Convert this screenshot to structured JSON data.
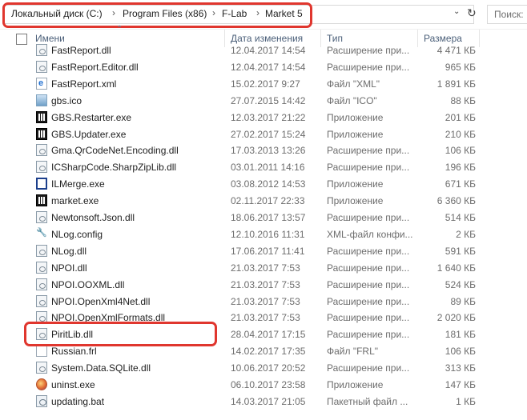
{
  "address": {
    "crumbs": [
      "Локальный диск (C:)",
      "Program Files (x86)",
      "F-Lab",
      "Market 5"
    ],
    "separator": "›",
    "dropdown_icon": "chevron-down-icon",
    "refresh_icon": "refresh-icon",
    "search_placeholder": "Поиск:"
  },
  "columns": {
    "name": "Имени",
    "date": "Дата изменения",
    "type": "Тип",
    "size": "Размера"
  },
  "highlight_color": "#e0362e",
  "files": [
    {
      "name": "FastReport.dll",
      "date": "12.04.2017 14:54",
      "type": "Расширение при...",
      "size": "4 471 КБ",
      "icon": "dll"
    },
    {
      "name": "FastReport.Editor.dll",
      "date": "12.04.2017 14:54",
      "type": "Расширение при...",
      "size": "965 КБ",
      "icon": "dll"
    },
    {
      "name": "FastReport.xml",
      "date": "15.02.2017 9:27",
      "type": "Файл \"XML\"",
      "size": "1 891 КБ",
      "icon": "xml"
    },
    {
      "name": "gbs.ico",
      "date": "27.07.2015 14:42",
      "type": "Файл \"ICO\"",
      "size": "88 КБ",
      "icon": "ico"
    },
    {
      "name": "GBS.Restarter.exe",
      "date": "12.03.2017 21:22",
      "type": "Приложение",
      "size": "201 КБ",
      "icon": "exe"
    },
    {
      "name": "GBS.Updater.exe",
      "date": "27.02.2017 15:24",
      "type": "Приложение",
      "size": "210 КБ",
      "icon": "exe"
    },
    {
      "name": "Gma.QrCodeNet.Encoding.dll",
      "date": "17.03.2013 13:26",
      "type": "Расширение при...",
      "size": "106 КБ",
      "icon": "dll"
    },
    {
      "name": "ICSharpCode.SharpZipLib.dll",
      "date": "03.01.2011 14:16",
      "type": "Расширение при...",
      "size": "196 КБ",
      "icon": "dll"
    },
    {
      "name": "ILMerge.exe",
      "date": "03.08.2012 14:53",
      "type": "Приложение",
      "size": "671 КБ",
      "icon": "il"
    },
    {
      "name": "market.exe",
      "date": "02.11.2017 22:33",
      "type": "Приложение",
      "size": "6 360 КБ",
      "icon": "exe"
    },
    {
      "name": "Newtonsoft.Json.dll",
      "date": "18.06.2017 13:57",
      "type": "Расширение при...",
      "size": "514 КБ",
      "icon": "dll"
    },
    {
      "name": "NLog.config",
      "date": "12.10.2016 11:31",
      "type": "XML-файл конфи...",
      "size": "2 КБ",
      "icon": "cfg"
    },
    {
      "name": "NLog.dll",
      "date": "17.06.2017 11:41",
      "type": "Расширение при...",
      "size": "591 КБ",
      "icon": "dll"
    },
    {
      "name": "NPOI.dll",
      "date": "21.03.2017 7:53",
      "type": "Расширение при...",
      "size": "1 640 КБ",
      "icon": "dll"
    },
    {
      "name": "NPOI.OOXML.dll",
      "date": "21.03.2017 7:53",
      "type": "Расширение при...",
      "size": "524 КБ",
      "icon": "dll"
    },
    {
      "name": "NPOI.OpenXml4Net.dll",
      "date": "21.03.2017 7:53",
      "type": "Расширение при...",
      "size": "89 КБ",
      "icon": "dll"
    },
    {
      "name": "NPOI.OpenXmlFormats.dll",
      "date": "21.03.2017 7:53",
      "type": "Расширение при...",
      "size": "2 020 КБ",
      "icon": "dll"
    },
    {
      "name": "PiritLib.dll",
      "date": "28.04.2017 17:15",
      "type": "Расширение при...",
      "size": "181 КБ",
      "icon": "dll"
    },
    {
      "name": "Russian.frl",
      "date": "14.02.2017 17:35",
      "type": "Файл \"FRL\"",
      "size": "106 КБ",
      "icon": "frl"
    },
    {
      "name": "System.Data.SQLite.dll",
      "date": "10.06.2017 20:52",
      "type": "Расширение при...",
      "size": "313 КБ",
      "icon": "sqlite"
    },
    {
      "name": "uninst.exe",
      "date": "06.10.2017 23:58",
      "type": "Приложение",
      "size": "147 КБ",
      "icon": "uninst"
    },
    {
      "name": "updating.bat",
      "date": "14.03.2017 21:05",
      "type": "Пакетный файл ...",
      "size": "1 КБ",
      "icon": "bat"
    }
  ]
}
